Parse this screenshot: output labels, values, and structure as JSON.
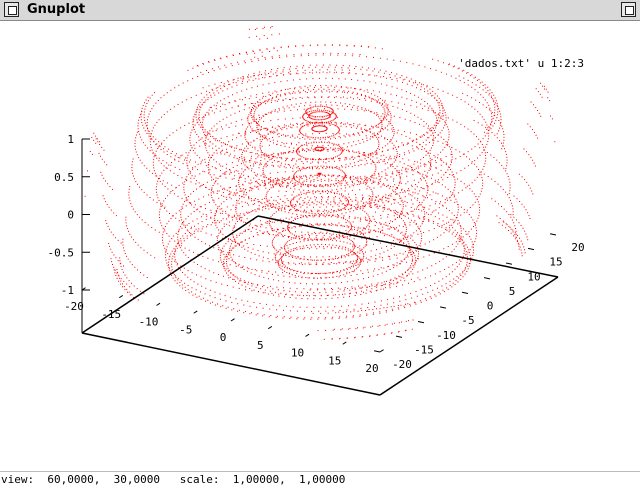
{
  "window": {
    "title": "Gnuplot"
  },
  "status": {
    "text": "view:  60,0000,  30,0000   scale:  1,00000,  1,00000"
  },
  "chart_data": {
    "type": "scatter",
    "mode": "3d-points",
    "view": {
      "rot_x": 60,
      "rot_z": 30,
      "scale": 1,
      "scale_z": 1
    },
    "legend": {
      "entries": [
        "'dados.txt' u 1:2:3"
      ],
      "position": "top-right"
    },
    "xrange": [
      -20,
      20
    ],
    "yrange": [
      -20,
      20
    ],
    "zrange": [
      -1,
      1
    ],
    "x_ticks": [
      "-20",
      "-15",
      "-10",
      "-5",
      "0",
      "5",
      "10",
      "15",
      "20"
    ],
    "y_ticks": [
      "-20",
      "-15",
      "-10",
      "-5",
      "0",
      "5",
      "10",
      "15",
      "20"
    ],
    "z_ticks": [
      "1",
      "0.5",
      "0",
      "-0.5",
      "-1"
    ],
    "point_color": "#ff0000",
    "function": "z = sin(sqrt(x^2 + y^2))",
    "sampling": {
      "radius_max": 20,
      "radial_steps": 80,
      "angular_steps": 110
    }
  }
}
